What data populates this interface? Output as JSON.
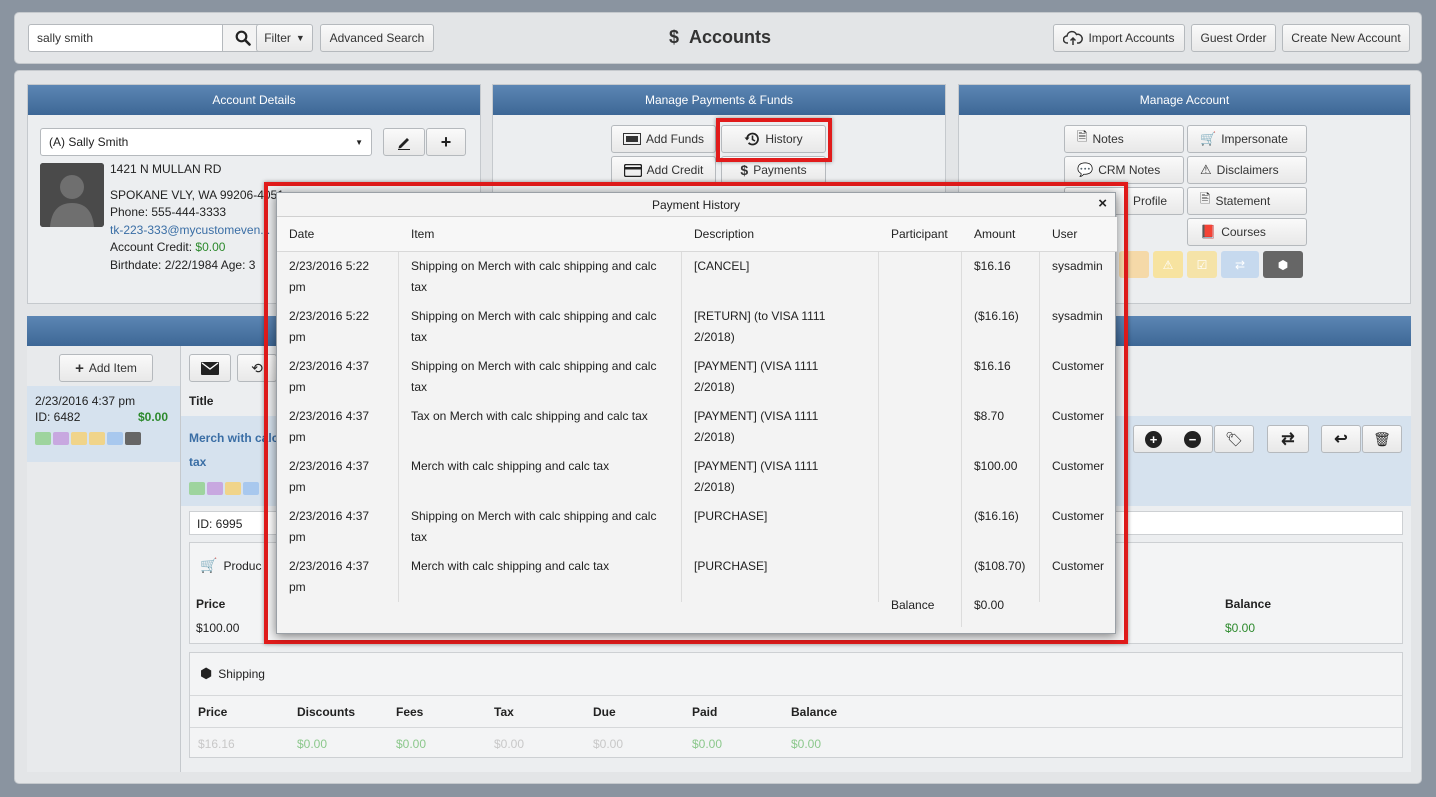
{
  "topbar": {
    "search_value": "sally smith",
    "filter_label": "Filter",
    "advanced_search_label": "Advanced Search",
    "title": "Accounts",
    "title_icon": "$",
    "import_label": "Import Accounts",
    "guest_order_label": "Guest Order",
    "create_label": "Create New Account"
  },
  "account_details": {
    "header": "Account Details",
    "selected_account": "(A) Sally Smith",
    "address1": "1421 N MULLAN RD",
    "address2": "SPOKANE VLY, WA 99206-4051",
    "phone": "Phone: 555-444-3333",
    "email": "tk-223-333@mycustomeven...",
    "credit_label": "Account Credit:",
    "credit_value": "$0.00",
    "birthdate": "Birthdate: 2/22/1984   Age: 3"
  },
  "payments_panel": {
    "header": "Manage Payments & Funds",
    "add_funds": "Add Funds",
    "history": "History",
    "add_credit": "Add Credit",
    "payments": "Payments"
  },
  "manage_account": {
    "header": "Manage Account",
    "notes": "Notes",
    "impersonate": "Impersonate",
    "crm_notes": "CRM Notes",
    "disclaimers": "Disclaimers",
    "profile": "Profile",
    "statement": "Statement",
    "courses": "Courses"
  },
  "orders": {
    "add_item": "Add Item",
    "order_date": "2/23/2016 4:37 pm",
    "order_id": "ID: 6482",
    "order_total": "$0.00",
    "title_col": "Title",
    "item_title_1": "Merch with calc",
    "item_title_2": "tax",
    "item_id": "ID: 6995",
    "product_label": "Produc",
    "price_label": "Price",
    "price_value": "$100.00",
    "balance_label": "Balance",
    "balance_value": "$0.00",
    "shipping_label": "Shipping",
    "ship_cols": [
      "Price",
      "Discounts",
      "Fees",
      "Tax",
      "Due",
      "Paid",
      "Balance"
    ],
    "ship_vals": [
      "$16.16",
      "$0.00",
      "$0.00",
      "$0.00",
      "$0.00",
      "$0.00",
      "$0.00"
    ]
  },
  "modal": {
    "title": "Payment History",
    "columns": [
      "Date",
      "Item",
      "Description",
      "Participant",
      "Amount",
      "User"
    ],
    "rows": [
      {
        "date": "2/23/2016 5:22 pm",
        "item": "Shipping on Merch with calc shipping and calc tax",
        "desc": "[CANCEL]",
        "participant": "",
        "amount": "$16.16",
        "user": "sysadmin",
        "neg": false
      },
      {
        "date": "2/23/2016 5:22 pm",
        "item": "Shipping on Merch with calc shipping and calc tax",
        "desc": "[RETURN] (to VISA 1111 2/2018)",
        "participant": "",
        "amount": "($16.16)",
        "user": "sysadmin",
        "neg": true
      },
      {
        "date": "2/23/2016 4:37 pm",
        "item": "Shipping on Merch with calc shipping and calc tax",
        "desc": "[PAYMENT] (VISA 1111 2/2018)",
        "participant": "",
        "amount": "$16.16",
        "user": "Customer",
        "neg": false
      },
      {
        "date": "2/23/2016 4:37 pm",
        "item": "Tax on Merch with calc shipping and calc tax",
        "desc": "[PAYMENT] (VISA 1111 2/2018)",
        "participant": "",
        "amount": "$8.70",
        "user": "Customer",
        "neg": false
      },
      {
        "date": "2/23/2016 4:37 pm",
        "item": "Merch with calc shipping and calc tax",
        "desc": "[PAYMENT] (VISA 1111 2/2018)",
        "participant": "",
        "amount": "$100.00",
        "user": "Customer",
        "neg": false
      },
      {
        "date": "2/23/2016 4:37 pm",
        "item": "Shipping on Merch with calc shipping and calc tax",
        "desc": "[PURCHASE]",
        "participant": "",
        "amount": "($16.16)",
        "user": "Customer",
        "neg": true
      },
      {
        "date": "2/23/2016 4:37 pm",
        "item": "Merch with calc shipping and calc tax",
        "desc": "[PURCHASE]",
        "participant": "",
        "amount": "($108.70)",
        "user": "Customer",
        "neg": true
      }
    ],
    "balance_label": "Balance",
    "balance_value": "$0.00"
  },
  "colors": {
    "header_blue": "#3d6796",
    "positive": "#2d8a2d",
    "negative": "#d32020",
    "highlight": "#e11b1b"
  }
}
